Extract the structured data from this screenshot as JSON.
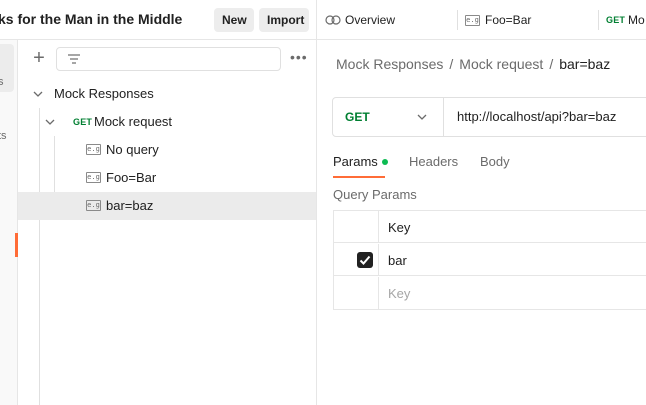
{
  "workspace": {
    "title": "ks for the Man in the Middle",
    "new_label": "New",
    "import_label": "Import"
  },
  "rail": {
    "frag_top": "s",
    "frag_mid": "ts"
  },
  "collection_tree": {
    "collection_name": "Mock Responses",
    "request_method": "GET",
    "request_name": "Mock request",
    "examples": [
      {
        "label": "No query",
        "icon": "e.g"
      },
      {
        "label": "Foo=Bar",
        "icon": "e.g"
      },
      {
        "label": "bar=baz",
        "icon": "e.g",
        "selected": true
      }
    ]
  },
  "tabs": [
    {
      "label": "Overview",
      "icon": "overview-icon"
    },
    {
      "label": "Foo=Bar",
      "icon": "e.g"
    },
    {
      "label": "Mo",
      "method": "GET"
    }
  ],
  "breadcrumb": {
    "items": [
      "Mock Responses",
      "Mock request",
      "bar=baz"
    ],
    "separator": "/"
  },
  "request": {
    "method": "GET",
    "url": "http://localhost/api?bar=baz"
  },
  "request_tabs": {
    "params": "Params",
    "headers": "Headers",
    "body": "Body"
  },
  "query_params": {
    "title": "Query Params",
    "header_key": "Key",
    "rows": [
      {
        "key": "bar",
        "checked": true
      }
    ],
    "placeholder_key": "Key"
  },
  "colors": {
    "accent": "#ff6c37",
    "get_method": "#007f31",
    "active_dot": "#0cbb52"
  }
}
